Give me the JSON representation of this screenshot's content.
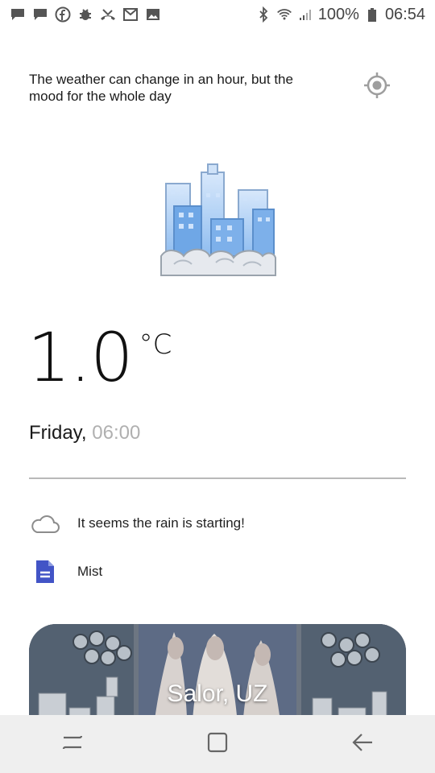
{
  "status_bar": {
    "battery": "100%",
    "time": "06:54",
    "left_icons": [
      "message-icon",
      "message-icon",
      "facebook-icon",
      "bug-icon",
      "missed-call-icon",
      "gmail-icon",
      "gallery-icon"
    ],
    "right_icons": [
      "bluetooth-icon",
      "wifi-icon",
      "signal-icon",
      "battery-icon"
    ]
  },
  "header": {
    "quote": "The weather can change in an hour, but the mood for the whole day",
    "location_icon": "target-location-icon"
  },
  "weather": {
    "illustration": "city-fog-illustration",
    "temperature": "1.0",
    "unit": "°C",
    "day": "Friday,",
    "time": "06:00",
    "condition_icon": "cloud-icon",
    "condition_text": "It seems the rain is starting!",
    "description_icon": "document-icon",
    "description_text": "Mist"
  },
  "location_card": {
    "title": "Salor, UZ"
  },
  "nav_bar": {
    "recent": "recent-apps-icon",
    "home": "home-icon",
    "back": "back-icon"
  },
  "colors": {
    "accent_blue": "#4254c6",
    "divider": "#b9b9b9",
    "muted_text": "#b0b0b0",
    "nav_background": "#efefef"
  }
}
